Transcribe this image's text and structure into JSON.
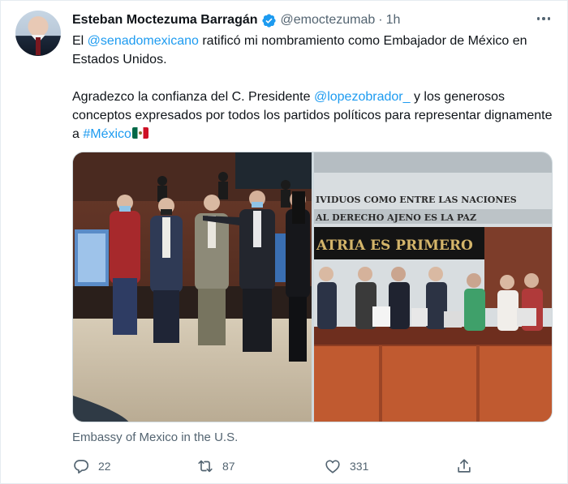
{
  "tweet": {
    "author_name": "Esteban Moctezuma Barragán",
    "handle": "@emoctezumab",
    "separator": "·",
    "time": "1h",
    "text": {
      "p1_prefix": "El ",
      "p1_mention": "@senadomexicano",
      "p1_suffix": " ratificó mi nombramiento como Embajador de México en Estados Unidos.",
      "p2_prefix": "Agradezco la confianza del C. Presidente ",
      "p2_mention": "@lopezobrador_",
      "p2_middle": " y los generosos conceptos expresados por todos los partidos políticos para representar dignamente a ",
      "p2_hashtag": "#México"
    },
    "media": {
      "left_photo": "ceremony-photo",
      "right_photo": "senate-photo",
      "banner_line1": "IVIDUOS COMO ENTRE LAS NACIONES",
      "banner_line2": "AL DERECHO AJENO ES LA PAZ",
      "banner_line3": "ATRIA ES PRIMERO"
    },
    "caption": "Embassy of Mexico in the U.S.",
    "actions": {
      "reply_count": "22",
      "retweet_count": "87",
      "like_count": "331"
    }
  },
  "colors": {
    "link": "#1d9bf0",
    "secondary_text": "#536471",
    "verified": "#1d9bf0"
  },
  "icons": [
    "verified-badge-icon",
    "more-icon",
    "reply-icon",
    "retweet-icon",
    "like-icon",
    "share-icon",
    "mexico-flag-emoji"
  ]
}
